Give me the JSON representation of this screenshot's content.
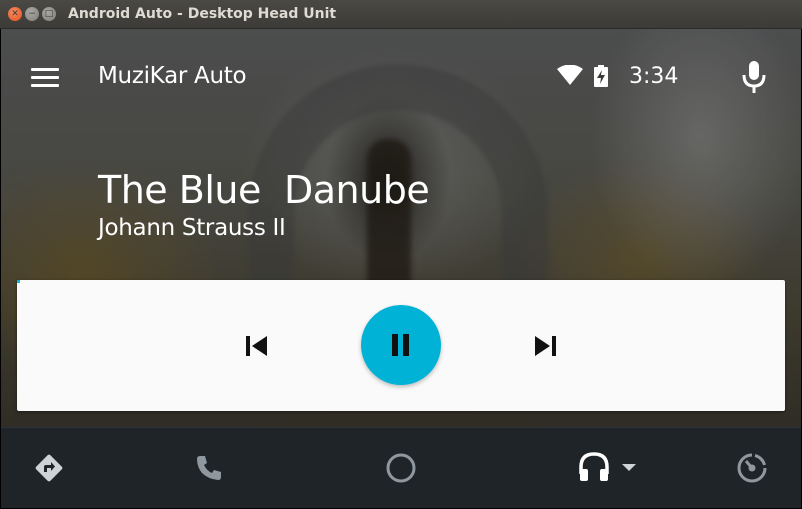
{
  "window": {
    "title": "Android Auto - Desktop Head Unit",
    "buttons": [
      "close",
      "minimize",
      "maximize"
    ]
  },
  "header": {
    "menu_icon": "hamburger-menu-icon",
    "app_title": "MuziKar Auto",
    "status_icons": [
      "wifi-icon",
      "battery-charging-icon"
    ],
    "time": "3:34",
    "mic_icon": "microphone-icon"
  },
  "now_playing": {
    "title": "The Blue  Danube",
    "artist": "Johann Strauss II"
  },
  "controls": {
    "prev_icon": "skip-previous-icon",
    "pause_icon": "pause-icon",
    "next_icon": "skip-next-icon",
    "accent_color": "#00b3d6"
  },
  "nav_bar": {
    "items": [
      {
        "name": "navigation",
        "icon": "navigation-diamond-icon"
      },
      {
        "name": "phone",
        "icon": "phone-icon"
      },
      {
        "name": "home",
        "icon": "circle-home-icon"
      },
      {
        "name": "media",
        "icon": "headphones-icon",
        "active": true
      },
      {
        "name": "overview",
        "icon": "speedometer-icon"
      }
    ],
    "background": "#1e2428"
  }
}
